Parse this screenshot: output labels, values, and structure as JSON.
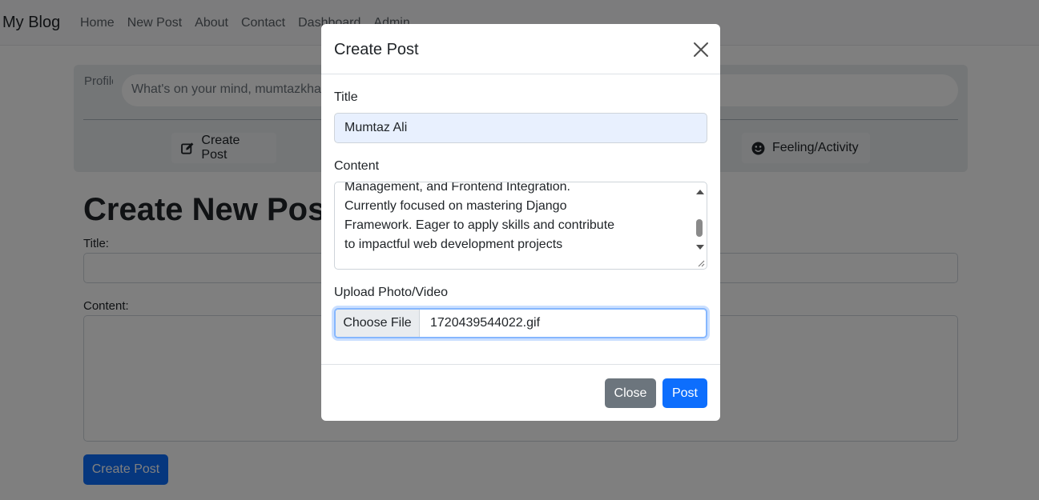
{
  "navbar": {
    "brand": "My Blog",
    "links": [
      "Home",
      "New Post",
      "About",
      "Contact",
      "Dashboard",
      "Admin"
    ]
  },
  "composer": {
    "avatar_alt": "Profile",
    "placeholder": "What's on your mind, mumtazkhan",
    "actions": [
      {
        "label": "Create Post",
        "icon": "edit-icon"
      },
      {
        "label": "Feeling/Activity",
        "icon": "smile-icon"
      }
    ]
  },
  "page": {
    "heading": "Create New Post",
    "title_label": "Title:",
    "content_label": "Content:",
    "submit_label": "Create Post"
  },
  "modal": {
    "title": "Create Post",
    "close_icon": "close-icon",
    "title_label": "Title",
    "title_value": "Mumtaz Ali",
    "content_label": "Content",
    "content_lines": [
      "Management, and Frontend Integration.",
      "Currently focused on mastering Django",
      "Framework. Eager to apply skills and contribute",
      "to impactful web development projects"
    ],
    "upload_label": "Upload Photo/Video",
    "choose_file_label": "Choose File",
    "file_name": "1720439544022.gif",
    "close_button": "Close",
    "post_button": "Post"
  },
  "colors": {
    "primary": "#0d6efd",
    "secondary": "#6c757d",
    "input_autofill": "#e8f0fe",
    "focus_ring": "#86b7fe"
  }
}
